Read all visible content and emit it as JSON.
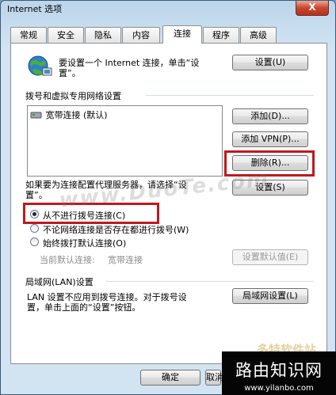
{
  "window": {
    "title": "Internet 选项",
    "close_label": "X"
  },
  "tabs": [
    {
      "label": "常规"
    },
    {
      "label": "安全"
    },
    {
      "label": "隐私"
    },
    {
      "label": "内容"
    },
    {
      "label": "连接",
      "active": true
    },
    {
      "label": "程序"
    },
    {
      "label": "高级"
    }
  ],
  "setup": {
    "description_line1": "要设置一个 Internet 连接，单击“设",
    "description_line2": "置”。",
    "button": "设置(U)"
  },
  "dialup": {
    "section_title": "拨号和虚拟专用网络设置",
    "connections": [
      {
        "label": "宽带连接 (默认)"
      }
    ],
    "add_button": "添加(D)...",
    "add_vpn_button": "添加 VPN(P)...",
    "delete_button": "删除(R)...",
    "settings_button": "设置(S)",
    "proxy_note_line1": "如果要为连接配置代理服务器，请选择“设",
    "proxy_note_line2": "置”。",
    "options": [
      {
        "label": "从不进行拨号连接(C)",
        "selected": true
      },
      {
        "label": "不论网络连接是否存在都进行拨号(W)",
        "selected": false
      },
      {
        "label": "始终拨打默认连接(O)",
        "selected": false
      }
    ],
    "current_default_label": "当前默认连接:",
    "current_default_value": "宽带连接",
    "set_default_button": "设置默认值(E)"
  },
  "lan": {
    "section_title": "局域网(LAN)设置",
    "note_line1": "LAN 设置不应用到拨号连接。对于拨号设",
    "note_line2": "置，单击上面的“设置”按钮。",
    "button": "局域网设置(L)"
  },
  "footer": {
    "ok_button": "确定",
    "cancel_button": "取消"
  },
  "watermark": {
    "text": "www.DuoTe.com",
    "logo_text": "多特软件站"
  },
  "brand": {
    "name": "路由知识网",
    "url": "www.yilanbo.com"
  },
  "colors": {
    "highlight_box": "#c0181f",
    "panel_bg": "#ffffff"
  }
}
